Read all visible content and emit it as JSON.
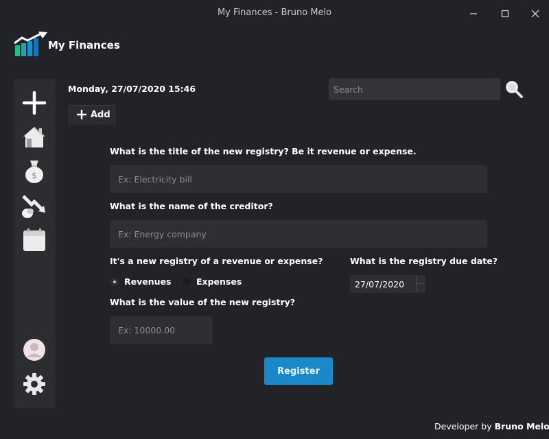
{
  "window": {
    "title": "My Finances - Bruno Melo"
  },
  "brand": {
    "name": "My Finances"
  },
  "sidebar": {
    "items": [
      {
        "icon": "plus-icon"
      },
      {
        "icon": "home-icon"
      },
      {
        "icon": "money-bag-icon"
      },
      {
        "icon": "expense-chart-icon"
      },
      {
        "icon": "calendar-icon"
      },
      {
        "icon": "user-avatar-icon"
      },
      {
        "icon": "gear-icon"
      }
    ]
  },
  "header": {
    "datetime": "Monday, 27/07/2020  15:46",
    "search_placeholder": "Search"
  },
  "tabs": [
    {
      "label": "Add"
    }
  ],
  "form": {
    "title_question": "What is the title of the new registry? Be it revenue or expense.",
    "title_placeholder": "Ex: Electricity bill",
    "creditor_question": "What is the name of the creditor?",
    "creditor_placeholder": "Ex: Energy company",
    "type_question": "It's a new registry of a revenue or expense?",
    "type_options": [
      "Revenues",
      "Expenses"
    ],
    "type_selected": "Revenues",
    "due_date_question": "What is the registry due date?",
    "due_date_value": "27/07/2020",
    "value_question": "What is the value of the new registry?",
    "value_placeholder": "Ex: 10000.00",
    "register_label": "Register"
  },
  "footer": {
    "prefix": "Developer by",
    "author": "Bruno Melo."
  },
  "colors": {
    "background": "#212328",
    "sidebar": "#2c2d31",
    "field": "#2e2f33",
    "accent": "#1a88c9"
  }
}
